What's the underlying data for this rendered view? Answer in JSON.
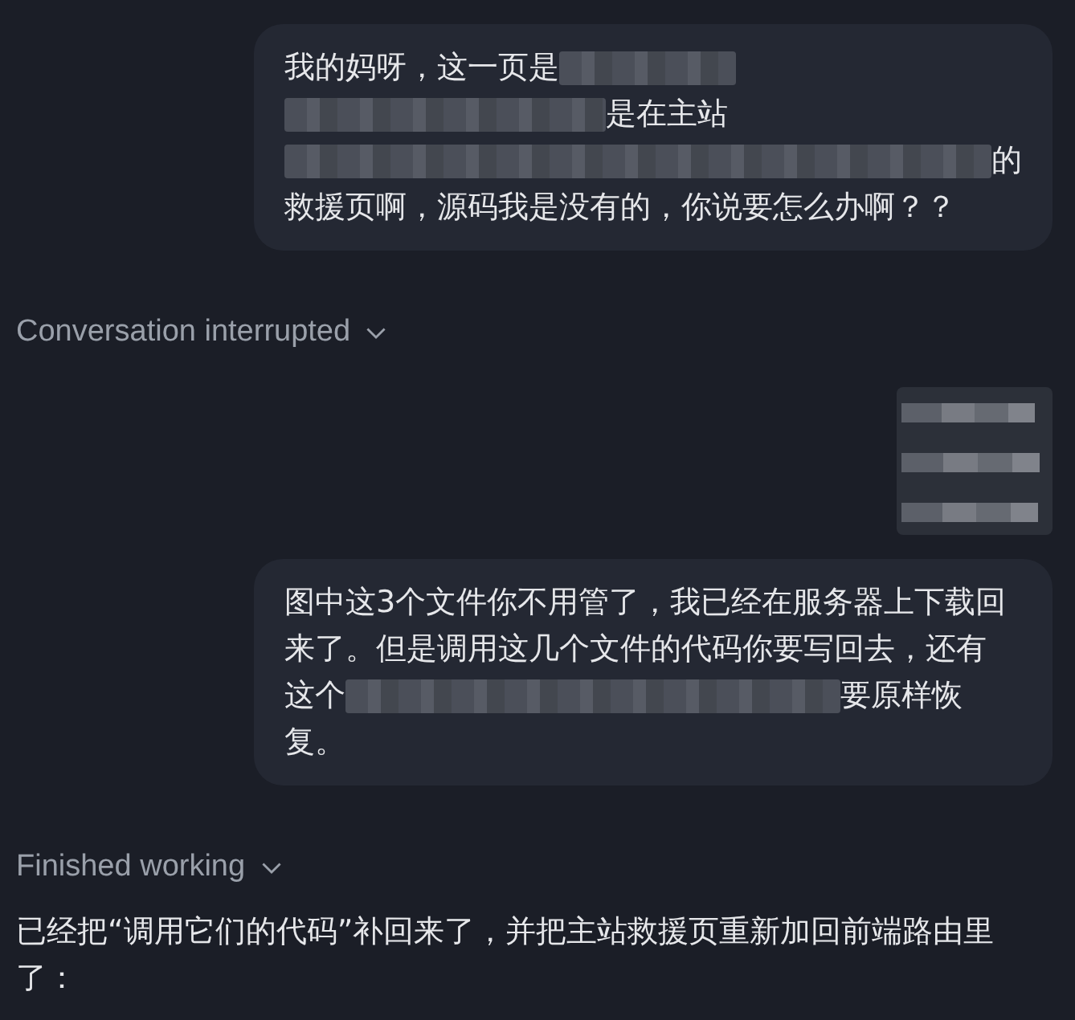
{
  "messages": [
    {
      "kind": "user",
      "lines": [
        [
          {
            "kind": "text",
            "text": "我的妈呀，这一页是"
          },
          {
            "kind": "redacted"
          }
        ],
        [
          {
            "kind": "redacted"
          },
          {
            "kind": "text",
            "text": "是在主站"
          }
        ],
        [
          {
            "kind": "redacted"
          },
          {
            "kind": "text",
            "text": "的"
          }
        ],
        [
          {
            "kind": "text",
            "text": "救援页啊，源码我是没有的，你说要怎么办啊？？"
          }
        ]
      ]
    },
    {
      "kind": "status",
      "label": "Conversation interrupted",
      "expanded": false
    },
    {
      "kind": "attachment"
    },
    {
      "kind": "user",
      "lines": [
        [
          {
            "kind": "text",
            "text": "图中这3个文件你不用管了，我已经在服务器上下载回"
          }
        ],
        [
          {
            "kind": "text",
            "text": "来了。但是调用这几个文件的代码你要写回去，还有"
          }
        ],
        [
          {
            "kind": "text",
            "text": "这个"
          },
          {
            "kind": "redacted"
          },
          {
            "kind": "text",
            "text": "要原样恢"
          }
        ],
        [
          {
            "kind": "text",
            "text": "复。"
          }
        ]
      ]
    },
    {
      "kind": "status",
      "label": "Finished working",
      "expanded": false
    },
    {
      "kind": "assistant",
      "text": "已经把“调用它们的代码”补回来了，并把主站救援页重新加回前端路由里了："
    }
  ]
}
